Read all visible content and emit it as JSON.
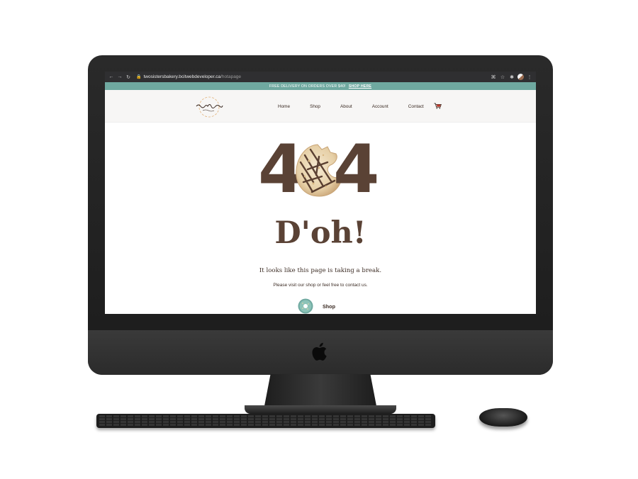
{
  "browser": {
    "url_host": "twosistersbakery.bcitwebdeveloper.ca",
    "url_path": "/hotapage"
  },
  "promo": {
    "text": "FREE DELIVERY ON ORDERS OVER $40!",
    "link": "SHOP HERE"
  },
  "logo": {
    "lettering": "two sisters bakery"
  },
  "nav": {
    "items": [
      "Home",
      "Shop",
      "About",
      "Account",
      "Contact"
    ]
  },
  "hero": {
    "code_left": "4",
    "code_right": "4",
    "heading": "D'oh!",
    "message": "It looks like this page is taking a break.",
    "sub": "Please visit our shop or feel free to contact us.",
    "shop_label": "Shop"
  },
  "colors": {
    "accent_teal": "#6fa9a0",
    "brand_brown": "#5a4235",
    "text_dark": "#3a2a22"
  },
  "icons": [
    "back-icon",
    "forward-icon",
    "reload-icon",
    "lock-icon",
    "cart-icon",
    "donut-icon",
    "apple-logo-icon"
  ]
}
